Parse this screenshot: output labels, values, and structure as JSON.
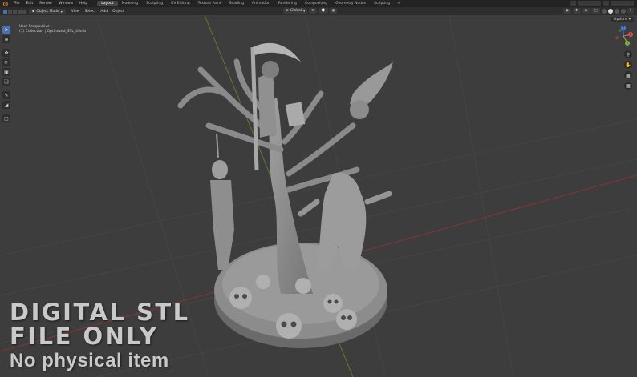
{
  "topbar": {
    "menus": [
      "File",
      "Edit",
      "Render",
      "Window",
      "Help"
    ],
    "workspaces": [
      "Layout",
      "Modeling",
      "Sculpting",
      "UV Editing",
      "Texture Paint",
      "Shading",
      "Animation",
      "Rendering",
      "Compositing",
      "Geometry Nodes",
      "Scripting"
    ],
    "active_workspace": "Layout",
    "add_workspace": "+"
  },
  "header": {
    "mode": "Object Mode",
    "menus": [
      "View",
      "Select",
      "Add",
      "Object"
    ],
    "transform_orientation": "Global"
  },
  "viewport": {
    "view_name": "User Perspective",
    "collection_info": "(1) Collection | Optimized_STL_43mb",
    "options_label": "Options"
  },
  "gizmo_axes": {
    "x": "X",
    "y": "Y",
    "z": "Z"
  },
  "overlay": {
    "line1": "DIGITAL STL",
    "line2": "FILE ONLY",
    "line3": "No physical item"
  },
  "colors": {
    "viewport_bg": "#3d3d3d",
    "grid_red_axis": "#8a3535",
    "grid_green_axis": "#5f7a2a",
    "accent": "#4772b3",
    "model_grey": "#8e8e8e"
  }
}
